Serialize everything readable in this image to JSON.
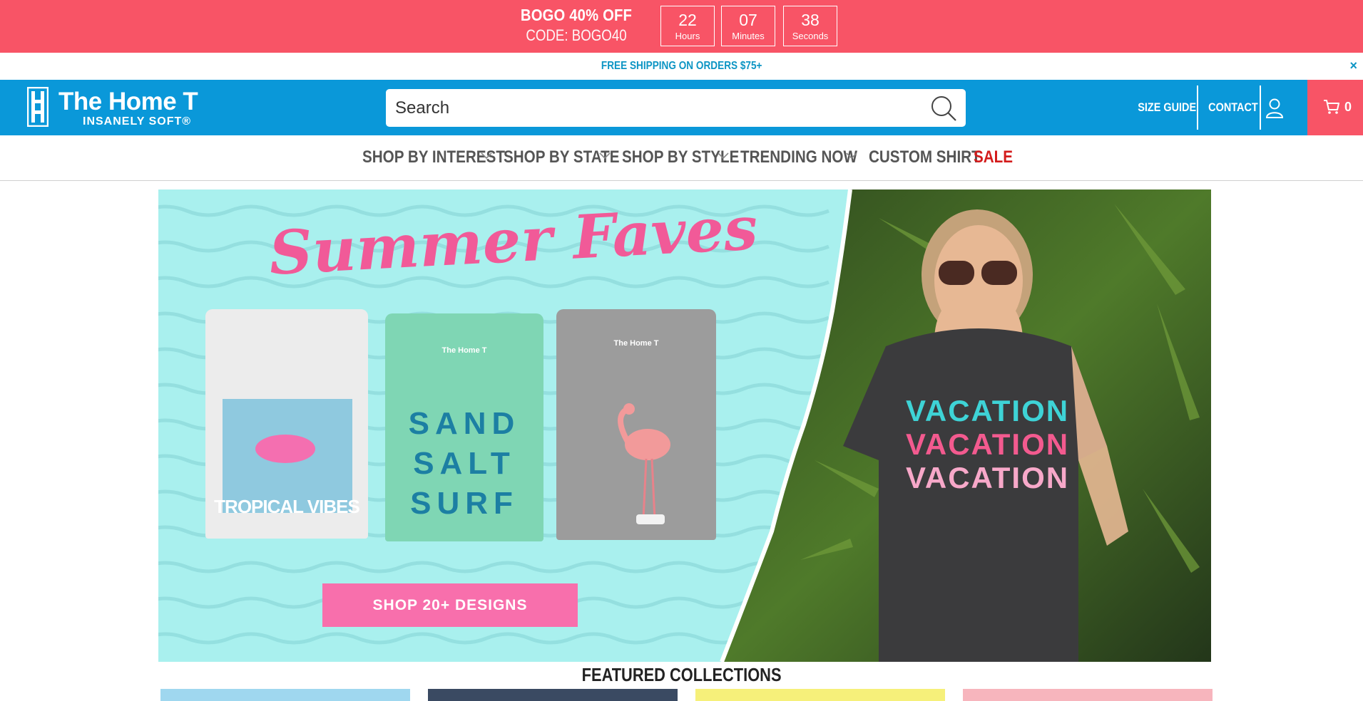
{
  "promo": {
    "title": "BOGO 40% OFF",
    "code": "CODE: BOGO40",
    "timer": [
      {
        "value": "22",
        "unit": "Hours"
      },
      {
        "value": "07",
        "unit": "Minutes"
      },
      {
        "value": "38",
        "unit": "Seconds"
      }
    ]
  },
  "shipping": {
    "text": "FREE SHIPPING ON ORDERS $75+",
    "close": "×"
  },
  "header": {
    "logo_name": "The Home T",
    "logo_tagline": "INSANELY SOFT®",
    "search_placeholder": "Search",
    "size_guide": "SIZE GUIDE",
    "contact": "CONTACT",
    "cart_count": "0"
  },
  "nav": {
    "items": [
      {
        "label": "SHOP BY INTEREST"
      },
      {
        "label": "SHOP BY STATE"
      },
      {
        "label": "SHOP BY STYLE"
      },
      {
        "label": "TRENDING NOW"
      },
      {
        "label": "CUSTOM SHIRT"
      },
      {
        "label": "SALE"
      }
    ],
    "sale_color": "#d31b1b"
  },
  "hero": {
    "title": "Summer Faves",
    "shirt1": "TROPICAL VIBES",
    "shirt2": [
      "SAND",
      "SALT",
      "SURF"
    ],
    "shirt_brand": "The Home T",
    "cta": "SHOP 20+ DESIGNS",
    "model_shirt": [
      "VACATION",
      "VACATION",
      "VACATION"
    ]
  },
  "featured": {
    "title": "FEATURED COLLECTIONS"
  },
  "colors": {
    "promo": "#f85466",
    "header": "#0a98d9",
    "accent_blue": "#0d95c4",
    "cart": "#f85466"
  }
}
